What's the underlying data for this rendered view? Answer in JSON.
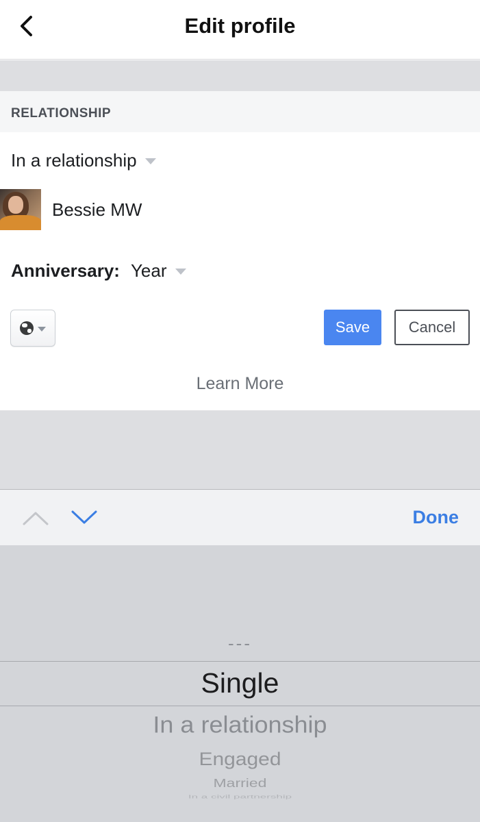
{
  "header": {
    "title": "Edit profile",
    "back_icon": "chevron-left-icon"
  },
  "section": {
    "header": "RELATIONSHIP"
  },
  "relationship": {
    "status": "In a relationship",
    "partner_name": "Bessie MW"
  },
  "anniversary": {
    "label": "Anniversary:",
    "year_placeholder": "Year"
  },
  "actions": {
    "privacy_icon": "globe-icon",
    "save_label": "Save",
    "cancel_label": "Cancel",
    "learn_more": "Learn More"
  },
  "keyboard_toolbar": {
    "done_label": "Done"
  },
  "picker": {
    "options": [
      "---",
      "Single",
      "In a relationship",
      "Engaged",
      "Married",
      "In a civil partnership"
    ],
    "selected": "Single"
  },
  "colors": {
    "primary_button": "#4a86f0",
    "done_text": "#3b7ee3",
    "gray_background": "#dddee1",
    "picker_background": "#d3d5d9"
  }
}
